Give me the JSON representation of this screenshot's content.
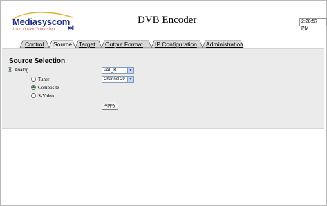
{
  "header": {
    "logo_text": "Mediasyscom",
    "logo_tagline": "Interactive Television",
    "title": "DVB Encoder",
    "clock": "2:28:57 PM"
  },
  "tabs": [
    {
      "label": "Control",
      "active": false
    },
    {
      "label": "Source",
      "active": true
    },
    {
      "label": "Target",
      "active": false
    },
    {
      "label": "Output Format",
      "active": false
    },
    {
      "label": "IP Configuration",
      "active": false
    },
    {
      "label": "Administration",
      "active": false
    }
  ],
  "source": {
    "heading": "Source Selection",
    "analog_label": "Analog",
    "analog_selected": true,
    "standard_value": "PAL_B",
    "tuner_label": "Tuner",
    "channel_value": "Channel 29",
    "composite_label": "Composite",
    "composite_selected": true,
    "svideo_label": "S-Video",
    "apply_label": "Apply"
  },
  "colors": {
    "panel_bg": "#ebebeb",
    "logo_blue": "#1f2f8a",
    "radio_dot": "#2b7a2b"
  }
}
